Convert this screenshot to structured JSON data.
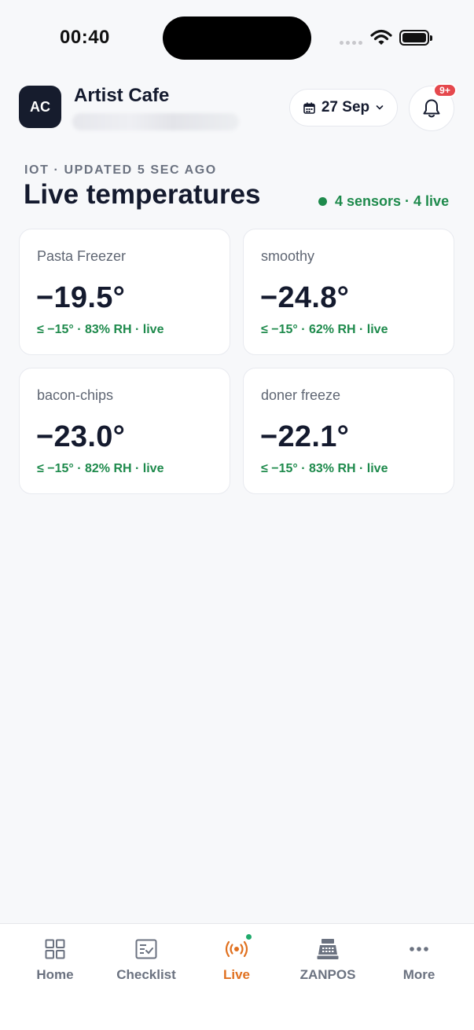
{
  "status_bar": {
    "time": "00:40"
  },
  "header": {
    "avatar_initials": "AC",
    "shop_name": "Artist Cafe",
    "date": "27 Sep",
    "notification_badge": "9+"
  },
  "section": {
    "eyebrow": "IOT · UPDATED 5 SEC AGO",
    "title": "Live temperatures",
    "summary": "4 sensors · 4 live"
  },
  "sensors": [
    {
      "name": "Pasta Freezer",
      "temp": "−19.5°",
      "meta": "≤ −15° · 83% RH · live"
    },
    {
      "name": "smoothy",
      "temp": "−24.8°",
      "meta": "≤ −15° · 62% RH · live"
    },
    {
      "name": "bacon-chips",
      "temp": "−23.0°",
      "meta": "≤ −15° · 82% RH · live"
    },
    {
      "name": "doner freeze",
      "temp": "−22.1°",
      "meta": "≤ −15° · 83% RH · live"
    }
  ],
  "tabs": [
    {
      "label": "Home",
      "icon": "grid-icon"
    },
    {
      "label": "Checklist",
      "icon": "checklist-icon"
    },
    {
      "label": "Live",
      "icon": "broadcast-icon",
      "active": true
    },
    {
      "label": "ZANPOS",
      "icon": "cash-register-icon"
    },
    {
      "label": "More",
      "icon": "more-dots-icon"
    }
  ],
  "colors": {
    "accent": "#e0701f",
    "live_green": "#1e8a4c",
    "badge_red": "#e5484d",
    "avatar_bg": "#161c2d"
  }
}
